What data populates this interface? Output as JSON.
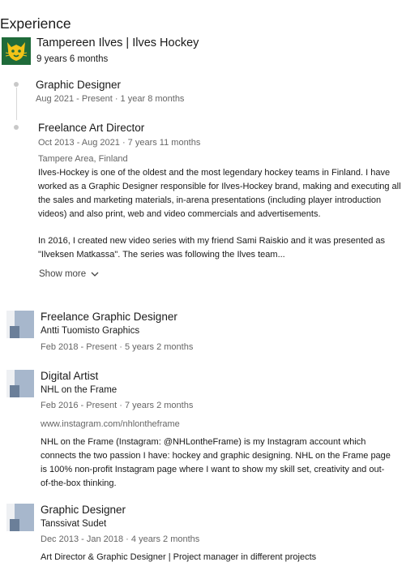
{
  "section": {
    "title": "Experience"
  },
  "ilves": {
    "company": "Tampereen Ilves | Ilves Hockey",
    "duration": "9 years 6 months",
    "roles": [
      {
        "title": "Graphic Designer",
        "dates": "Aug 2021 - Present · 1 year 8 months"
      },
      {
        "title": "Freelance Art Director",
        "dates": "Oct 2013 - Aug 2021 · 7 years 11 months",
        "location": "Tampere Area, Finland",
        "desc_lines": [
          "Ilves-Hockey is one of the oldest and the most legendary hockey teams in Finland. I have",
          "worked as a Graphic Designer responsible for Ilves-Hockey brand, making and executing all",
          "the sales and marketing materials, in-arena presentations (including player introduction",
          "videos) and also print, web and video commercials and advertisements."
        ],
        "desc2_lines": [
          "In 2016, I created new video series with my friend Sami Raiskio and it was presented as",
          "\"Ilveksen Matkassa\". The series was following the Ilves team..."
        ],
        "show_more": "Show more"
      }
    ]
  },
  "positions": [
    {
      "title": "Freelance Graphic Designer",
      "company": "Antti Tuomisto Graphics",
      "dates": "Feb 2018 - Present · 5 years 2 months"
    },
    {
      "title": "Digital Artist",
      "company": "NHL on the Frame",
      "dates": "Feb 2016 - Present · 7 years 2 months",
      "link": "www.instagram.com/nhlontheframe",
      "desc_lines": [
        "NHL on the Frame (Instagram: @NHLontheFrame) is my Instagram account which",
        "connects the two passion I have: hockey and graphic designing. NHL on the Frame page",
        "is 100% non-profit Instagram page where I want to show my skill set, creativity and out-",
        "of-the-box thinking."
      ]
    },
    {
      "title": "Graphic Designer",
      "company": "Tanssivat Sudet",
      "dates": "Dec 2013 - Jan 2018 · 4 years 2 months",
      "desc_lines": [
        "Art Director & Graphic Designer | Project manager in different projects"
      ]
    }
  ],
  "colors": {
    "logo_green": "#1f6b3a",
    "logo_yellow": "#f2c318"
  }
}
